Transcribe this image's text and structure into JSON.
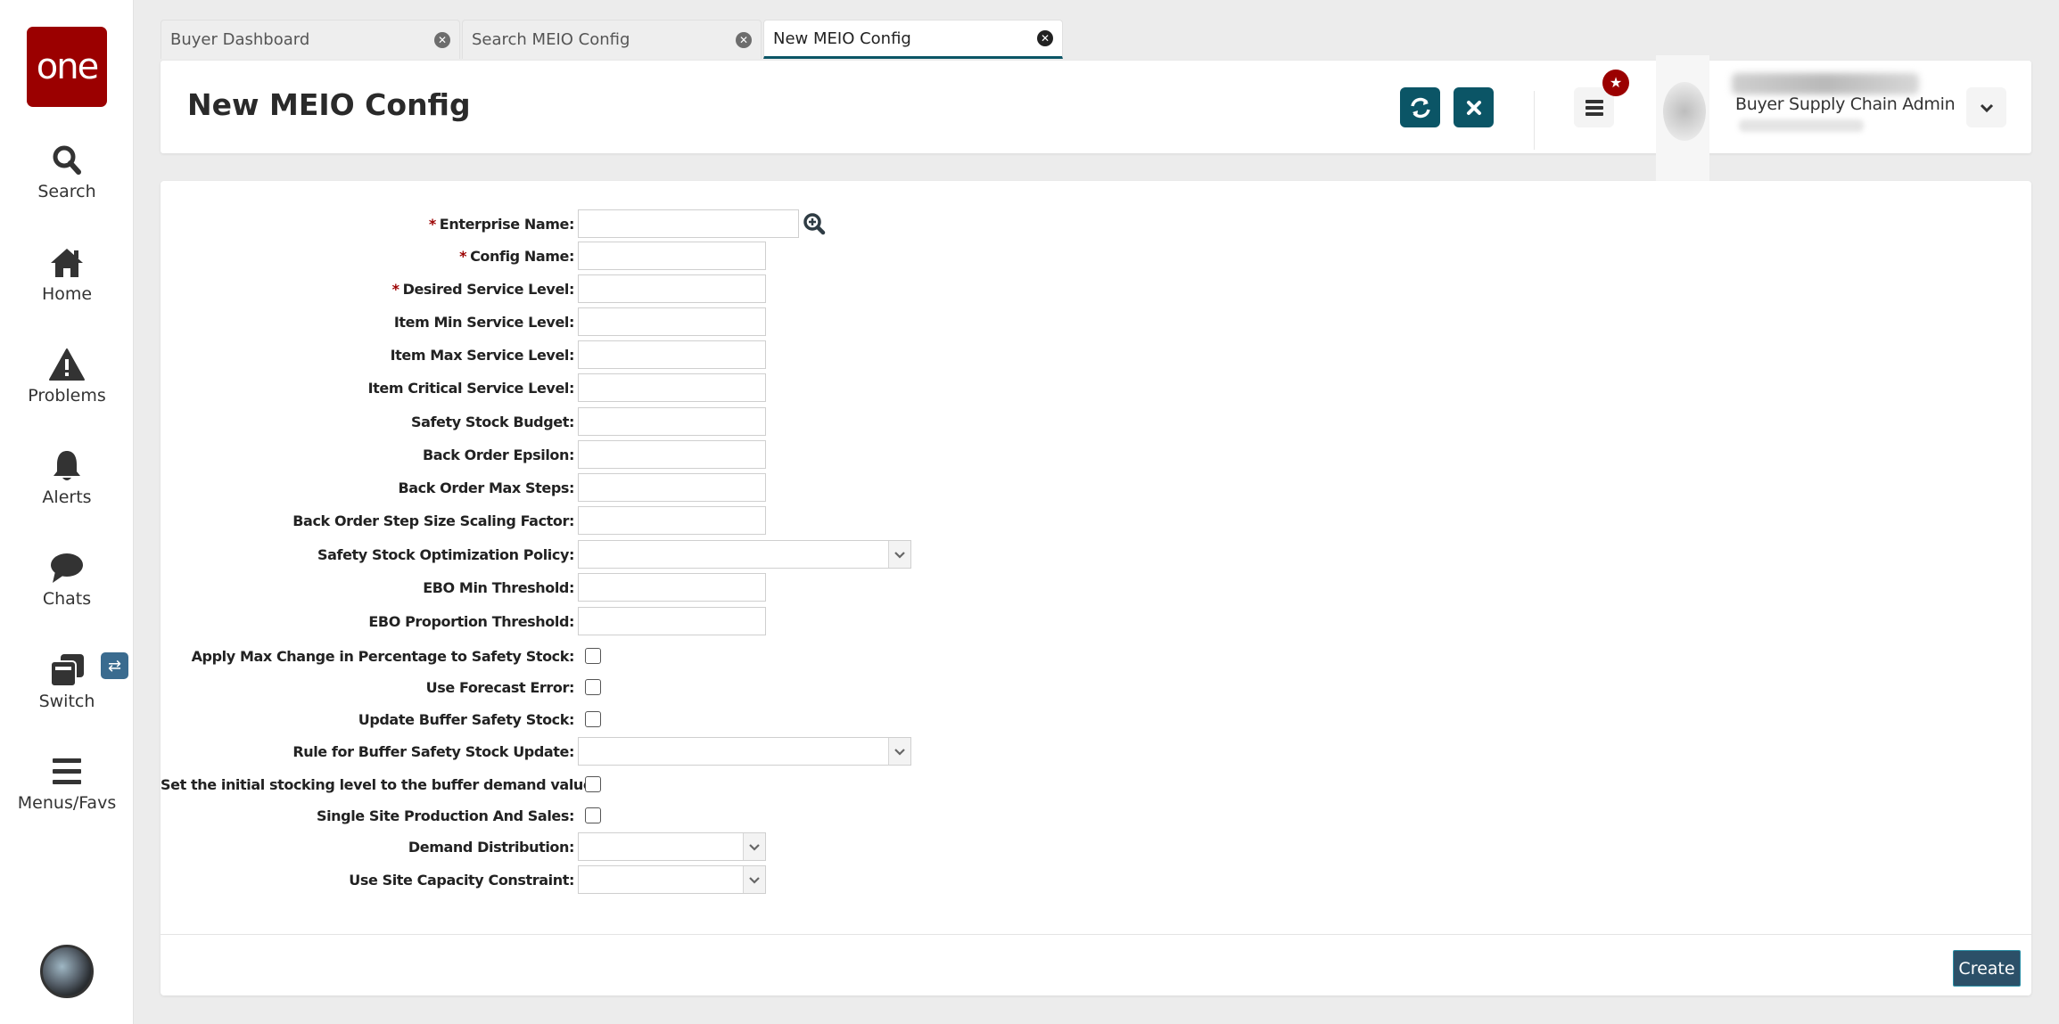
{
  "sidebar": {
    "logo_text": "one",
    "items": [
      {
        "label": "Search",
        "icon": "search-icon"
      },
      {
        "label": "Home",
        "icon": "home-icon"
      },
      {
        "label": "Problems",
        "icon": "warning-icon"
      },
      {
        "label": "Alerts",
        "icon": "bell-icon"
      },
      {
        "label": "Chats",
        "icon": "chat-icon"
      },
      {
        "label": "Switch",
        "icon": "switch-windows-icon"
      },
      {
        "label": "Menus/Favs",
        "icon": "menu-icon"
      }
    ],
    "switch_badge_icon": "exchange-icon",
    "assistant_icon": "ai-assistant-avatar"
  },
  "tabs": [
    {
      "label": "Buyer Dashboard",
      "active": false
    },
    {
      "label": "Search MEIO Config",
      "active": false
    },
    {
      "label": "New MEIO Config",
      "active": true
    }
  ],
  "header": {
    "title": "New MEIO Config",
    "refresh_icon": "refresh-icon",
    "close_icon": "close-icon",
    "menu_icon": "hamburger-icon",
    "favorite_badge_icon": "star-icon",
    "user_role": "Buyer Supply Chain Admin"
  },
  "form": {
    "fields": [
      {
        "label": "Enterprise Name:",
        "type": "lookup",
        "required": true,
        "value": ""
      },
      {
        "label": "Config Name:",
        "type": "text",
        "required": true,
        "value": ""
      },
      {
        "label": "Desired Service Level:",
        "type": "text",
        "required": true,
        "value": ""
      },
      {
        "label": "Item Min Service Level:",
        "type": "text",
        "required": false,
        "value": ""
      },
      {
        "label": "Item Max Service Level:",
        "type": "text",
        "required": false,
        "value": ""
      },
      {
        "label": "Item Critical Service Level:",
        "type": "text",
        "required": false,
        "value": ""
      },
      {
        "label": "Safety Stock Budget:",
        "type": "text",
        "required": false,
        "value": ""
      },
      {
        "label": "Back Order Epsilon:",
        "type": "text",
        "required": false,
        "value": ""
      },
      {
        "label": "Back Order Max Steps:",
        "type": "text",
        "required": false,
        "value": ""
      },
      {
        "label": "Back Order Step Size Scaling Factor:",
        "type": "text",
        "required": false,
        "value": ""
      },
      {
        "label": "Safety Stock Optimization Policy:",
        "type": "select-wide",
        "required": false,
        "value": ""
      },
      {
        "label": "EBO Min Threshold:",
        "type": "text",
        "required": false,
        "value": ""
      },
      {
        "label": "EBO Proportion Threshold:",
        "type": "text",
        "required": false,
        "value": ""
      },
      {
        "label": "Apply Max Change in Percentage to Safety Stock:",
        "type": "checkbox",
        "required": false,
        "checked": false
      },
      {
        "label": "Use Forecast Error:",
        "type": "checkbox",
        "required": false,
        "checked": false
      },
      {
        "label": "Update Buffer Safety Stock:",
        "type": "checkbox",
        "required": false,
        "checked": false
      },
      {
        "label": "Rule for Buffer Safety Stock Update:",
        "type": "select-wide",
        "required": false,
        "value": ""
      },
      {
        "label": "Set the initial stocking level to the buffer demand value:",
        "type": "checkbox",
        "required": false,
        "checked": false
      },
      {
        "label": "Single Site Production And Sales:",
        "type": "checkbox",
        "required": false,
        "checked": false
      },
      {
        "label": "Demand Distribution:",
        "type": "select-narrow",
        "required": false,
        "value": ""
      },
      {
        "label": "Use Site Capacity Constraint:",
        "type": "select-narrow",
        "required": false,
        "value": ""
      }
    ],
    "required_marker": "*",
    "create_label": "Create"
  },
  "colors": {
    "brand_red": "#9b0000",
    "action_teal": "#0b5566",
    "create_button": "#2c5068"
  }
}
